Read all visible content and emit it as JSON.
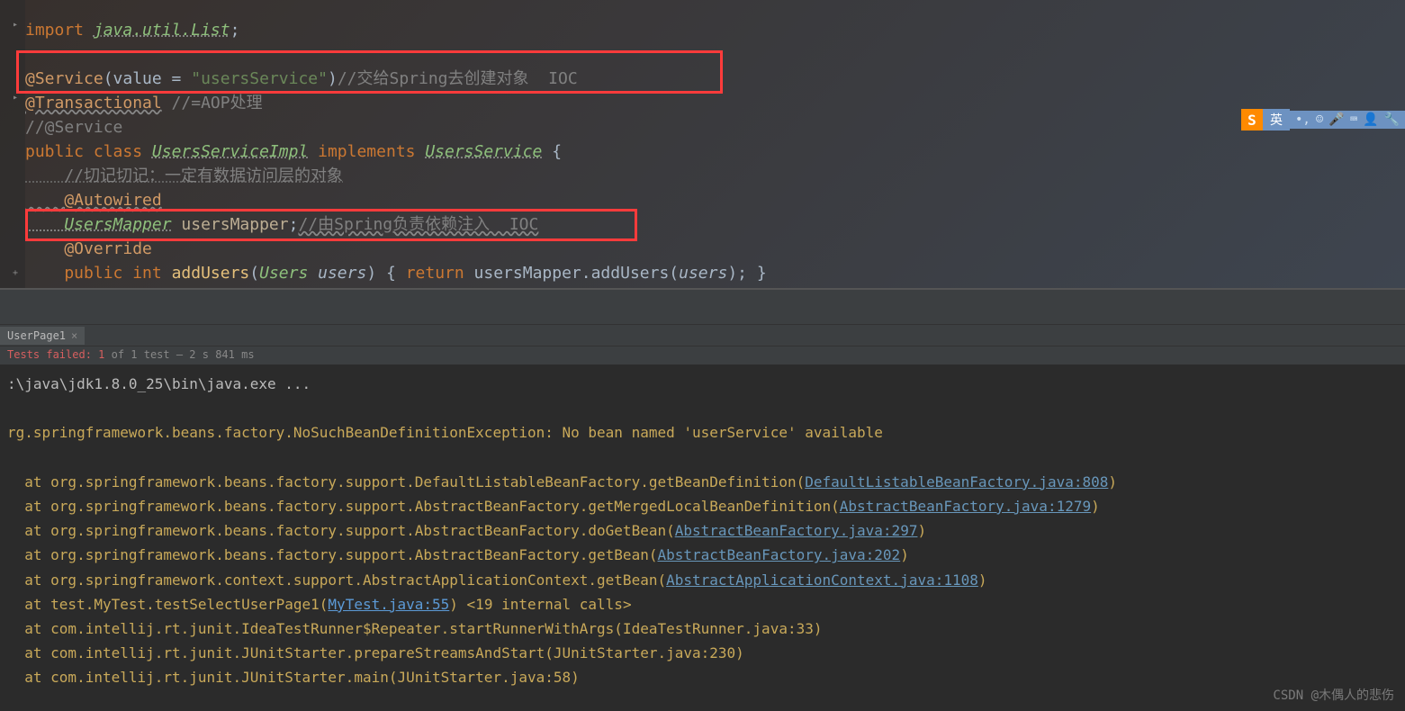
{
  "editor": {
    "import_kw": "import ",
    "import_pkg": "java.util.List",
    "import_semi": ";",
    "service_ann": "@Service",
    "service_args": "(value = ",
    "service_str": "\"usersService\"",
    "service_close": ")",
    "service_comment": "//交给Spring去创建对象  IOC",
    "transactional_ann": "@Transactional",
    "transactional_comment": " //=AOP处理",
    "service_comment2": "//@Service",
    "public_class": "public class ",
    "class_name": "UsersServiceImpl",
    "implements_kw": " implements ",
    "iface_name": "UsersService",
    "brace_open": " {",
    "comment_dao": "    //切记切记：一定有数据访问层的对象",
    "autowired": "    @Autowired",
    "mapper_type": "    UsersMapper",
    "mapper_var": " usersMapper",
    "mapper_semi": ";",
    "mapper_comment": "//由Spring负责依赖注入  IOC",
    "override": "    @Override",
    "method_sig1": "    public int ",
    "method_name": "addUsers",
    "method_paren": "(",
    "param_type": "Users",
    "param_name": " users",
    "method_body": ") { ",
    "return_kw": "return ",
    "method_call": "usersMapper.addUsers(",
    "call_arg": "users",
    "method_end": "); }"
  },
  "ime": {
    "logo": "S",
    "lang": "英",
    "icons": [
      "•,",
      "☺",
      "🎤",
      "⌨",
      "👤",
      "🔧"
    ]
  },
  "tab": {
    "name": "UserPage1",
    "close": "×"
  },
  "status": {
    "fail_label": "Tests failed: 1",
    "rest": " of 1 test – 2 s 841 ms"
  },
  "console": {
    "cmd": ":\\java\\jdk1.8.0_25\\bin\\java.exe ...",
    "exception": "rg.springframework.beans.factory.NoSuchBeanDefinitionException: No bean named 'userService' available",
    "stack": [
      {
        "pre": "  at org.springframework.beans.factory.support.DefaultListableBeanFactory.getBeanDefinition(",
        "link": "DefaultListableBeanFactory.java:808",
        "post": ")"
      },
      {
        "pre": "  at org.springframework.beans.factory.support.AbstractBeanFactory.getMergedLocalBeanDefinition(",
        "link": "AbstractBeanFactory.java:1279",
        "post": ")"
      },
      {
        "pre": "  at org.springframework.beans.factory.support.AbstractBeanFactory.doGetBean(",
        "link": "AbstractBeanFactory.java:297",
        "post": ")"
      },
      {
        "pre": "  at org.springframework.beans.factory.support.AbstractBeanFactory.getBean(",
        "link": "AbstractBeanFactory.java:202",
        "post": ")"
      },
      {
        "pre": "  at org.springframework.context.support.AbstractApplicationContext.getBean(",
        "link": "AbstractApplicationContext.java:1108",
        "post": ")"
      },
      {
        "pre": "  at test.MyTest.testSelectUserPage1(",
        "link": "MyTest.java:55",
        "link_class": "test",
        "post": ") <19 internal calls>"
      },
      {
        "pre": "  at com.intellij.rt.junit.IdeaTestRunner$Repeater.startRunnerWithArgs(IdeaTestRunner.java:33)",
        "link": "",
        "post": ""
      },
      {
        "pre": "  at com.intellij.rt.junit.JUnitStarter.prepareStreamsAndStart(JUnitStarter.java:230)",
        "link": "",
        "post": ""
      },
      {
        "pre": "  at com.intellij.rt.junit.JUnitStarter.main(JUnitStarter.java:58)",
        "link": "",
        "post": ""
      }
    ]
  },
  "watermark": "CSDN @木偶人的悲伤"
}
